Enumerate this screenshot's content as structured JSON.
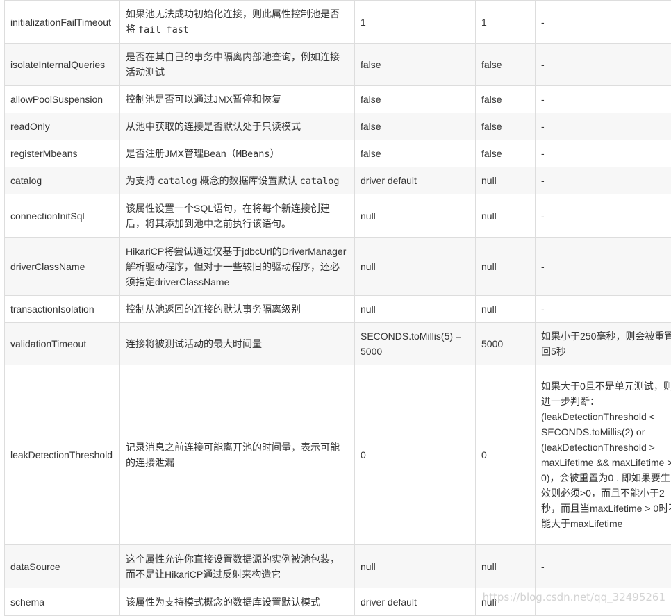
{
  "rows": [
    {
      "name": "initializationFailTimeout",
      "desc_parts": [
        "如果池无法成功初始化连接，则此属性控制池是否将 ",
        {
          "code": "fail fast"
        }
      ],
      "default": "1",
      "hikari": "1",
      "note": "-"
    },
    {
      "name": "isolateInternalQueries",
      "desc_parts": [
        "是否在其自己的事务中隔离内部池查询，例如连接活动测试"
      ],
      "default": "false",
      "hikari": "false",
      "note": "-"
    },
    {
      "name": "allowPoolSuspension",
      "desc_parts": [
        "控制池是否可以通过JMX暂停和恢复"
      ],
      "default": "false",
      "hikari": "false",
      "note": "-"
    },
    {
      "name": "readOnly",
      "desc_parts": [
        "从池中获取的连接是否默认处于只读模式"
      ],
      "default": "false",
      "hikari": "false",
      "note": "-"
    },
    {
      "name": "registerMbeans",
      "desc_parts": [
        "是否注册JMX管理Bean（",
        {
          "code": "MBeans"
        },
        "）"
      ],
      "default": "false",
      "hikari": "false",
      "note": "-"
    },
    {
      "name": "catalog",
      "desc_parts": [
        "为支持 ",
        {
          "code": "catalog"
        },
        " 概念的数据库设置默认 ",
        {
          "code": "catalog"
        }
      ],
      "default": "driver default",
      "hikari": "null",
      "note": "-"
    },
    {
      "name": "connectionInitSql",
      "desc_parts": [
        "该属性设置一个SQL语句，在将每个新连接创建后，将其添加到池中之前执行该语句。"
      ],
      "default": "null",
      "hikari": "null",
      "note": "-"
    },
    {
      "name": "driverClassName",
      "desc_parts": [
        "HikariCP将尝试通过仅基于jdbcUrl的DriverManager解析驱动程序，但对于一些较旧的驱动程序，还必须指定driverClassName"
      ],
      "default": "null",
      "hikari": "null",
      "note": "-"
    },
    {
      "name": "transactionIsolation",
      "desc_parts": [
        "控制从池返回的连接的默认事务隔离级别"
      ],
      "default": "null",
      "hikari": "null",
      "note": "-"
    },
    {
      "name": "validationTimeout",
      "desc_parts": [
        "连接将被测试活动的最大时间量"
      ],
      "default": "SECONDS.toMillis(5) = 5000",
      "hikari": "5000",
      "note": "如果小于250毫秒，则会被重置回5秒"
    },
    {
      "name": "leakDetectionThreshold",
      "desc_parts": [
        "记录消息之前连接可能离开池的时间量，表示可能的连接泄漏"
      ],
      "default": "0",
      "hikari": "0",
      "note": "如果大于0且不是单元测试，则进一步判断：(leakDetectionThreshold < SECONDS.toMillis(2) or (leakDetectionThreshold > maxLifetime && maxLifetime > 0)，会被重置为0 . 即如果要生效则必须>0，而且不能小于2秒，而且当maxLifetime > 0时不能大于maxLifetime"
    },
    {
      "name": "dataSource",
      "desc_parts": [
        "这个属性允许你直接设置数据源的实例被池包装，而不是让HikariCP通过反射来构造它"
      ],
      "default": "null",
      "hikari": "null",
      "note": "-"
    },
    {
      "name": "schema",
      "desc_parts": [
        "该属性为支持模式概念的数据库设置默认模式"
      ],
      "default": "driver default",
      "hikari": "null",
      "note": ""
    }
  ],
  "watermark": "https://blog.csdn.net/qq_32495261"
}
